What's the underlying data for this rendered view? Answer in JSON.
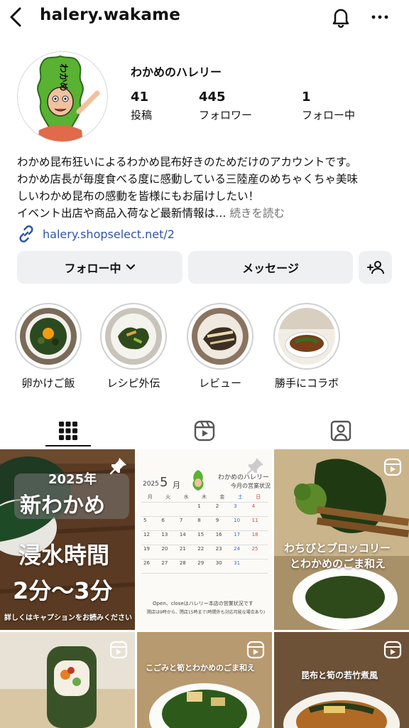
{
  "header": {
    "username": "halery.wakame"
  },
  "profile": {
    "display_name": "わかめのハレリー",
    "avatar_text": "わかめ",
    "stats": [
      {
        "value": "41",
        "label": "投稿"
      },
      {
        "value": "445",
        "label": "フォロワー"
      },
      {
        "value": "1",
        "label": "フォロー中"
      }
    ],
    "bio_lines": [
      "わかめ昆布狂いによるわかめ昆布好きのためだけのアカウントです。",
      "わかめ店長が毎度食べる度に感動している三陸産のめちゃくちゃ美味",
      "しいわかめ昆布の感動を皆様にもお届けしたい！",
      "イベント出店や商品入荷など最新情報は…"
    ],
    "bio_more": "続きを読む",
    "link": "halery.shopselect.net/2"
  },
  "actions": {
    "following": "フォロー中",
    "message": "メッセージ"
  },
  "highlights": [
    {
      "label": "卵かけご飯"
    },
    {
      "label": "レシピ外伝"
    },
    {
      "label": "レビュー"
    },
    {
      "label": "勝手にコラボ"
    }
  ],
  "posts": {
    "p1": {
      "year": "2025年",
      "title": "新わかめ",
      "line1": "浸水時間",
      "line2": "2分〜3分",
      "caption": "詳しくはキャプションをお読みください"
    },
    "p2": {
      "year": "2025",
      "month": "5",
      "month_unit": "月",
      "shop": "わかめのハレリー",
      "subtitle": "今月の営業状況",
      "weekdays": [
        "月",
        "火",
        "水",
        "木",
        "金",
        "土",
        "日"
      ],
      "days": [
        "1",
        "2",
        "3",
        "4",
        "5",
        "6",
        "7",
        "8",
        "9",
        "10",
        "11",
        "12",
        "13",
        "14",
        "15",
        "16",
        "17",
        "18",
        "19",
        "20",
        "21",
        "22",
        "23",
        "24",
        "25",
        "26",
        "27",
        "28",
        "29",
        "30",
        "31"
      ],
      "foot1": "Open、closeはハレリー本店の営業状況です",
      "foot2": "開店は9時から、閉店15時まで(時間外も対応可能な場合あり)"
    },
    "p3": {
      "line1": "わちびとブロッコリー",
      "line2": "とわかめのごま和え"
    },
    "p5": {
      "line1": "こごみと筍とわかめのごま和え"
    },
    "p6": {
      "line1": "昆布と筍の若竹煮風"
    }
  },
  "colors": {
    "link": "#3154a8",
    "button_bg": "#eff0f2",
    "muted": "#737373",
    "avatar_green": "#59b232"
  }
}
